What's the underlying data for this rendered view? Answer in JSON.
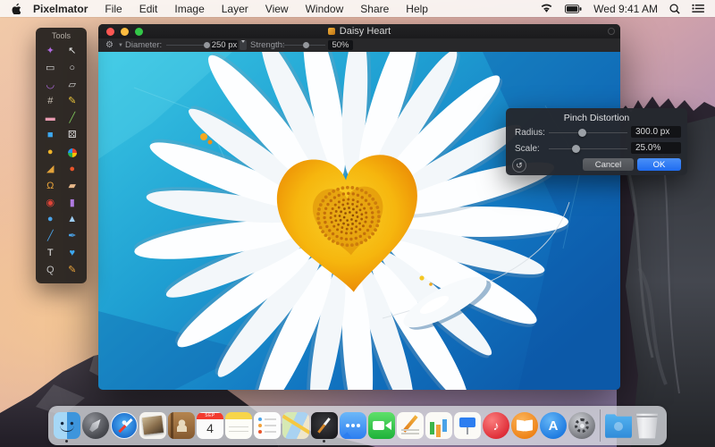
{
  "menubar": {
    "menus": [
      {
        "label": "Pixelmator",
        "bold": true
      },
      {
        "label": "File"
      },
      {
        "label": "Edit"
      },
      {
        "label": "Image"
      },
      {
        "label": "Layer"
      },
      {
        "label": "View"
      },
      {
        "label": "Window"
      },
      {
        "label": "Share"
      },
      {
        "label": "Help"
      }
    ],
    "status": {
      "clock": "Wed 9:41 AM"
    }
  },
  "tools_palette": {
    "title": "Tools",
    "tools": [
      {
        "name": "magic-wand",
        "glyph": "✦",
        "color": "#b06ae0"
      },
      {
        "name": "move",
        "glyph": "↖",
        "color": "#e8e8e8"
      },
      {
        "name": "rect-select",
        "glyph": "▭",
        "color": "#d8d8d8"
      },
      {
        "name": "ellipse-select",
        "glyph": "○",
        "color": "#d8d8d8"
      },
      {
        "name": "lasso",
        "glyph": "◡",
        "color": "#b06ae0"
      },
      {
        "name": "poly-lasso",
        "glyph": "▱",
        "color": "#d8d8d8"
      },
      {
        "name": "crop",
        "glyph": "#",
        "color": "#c8c0b4"
      },
      {
        "name": "pencil",
        "glyph": "✎",
        "color": "#e8c33a"
      },
      {
        "name": "eraser",
        "glyph": "▬",
        "color": "#e89ab0"
      },
      {
        "name": "line",
        "glyph": "╱",
        "color": "#7ec45a"
      },
      {
        "name": "rect-shape",
        "glyph": "■",
        "color": "#3da8f0"
      },
      {
        "name": "roll",
        "glyph": "⚄",
        "color": "#e0e0e0"
      },
      {
        "name": "ellipse-shape",
        "glyph": "●",
        "color": "#f0b429"
      },
      {
        "name": "gradient",
        "glyph": "",
        "color": "",
        "shape": "pinwheel"
      },
      {
        "name": "paint-bucket",
        "glyph": "◢",
        "color": "#e2a23a"
      },
      {
        "name": "color-drop",
        "glyph": "●",
        "color": "#e8542a"
      },
      {
        "name": "clone-stamp",
        "glyph": "Ω",
        "color": "#e8a23a"
      },
      {
        "name": "healing",
        "glyph": "▰",
        "color": "#e8b88a"
      },
      {
        "name": "red-eye",
        "glyph": "◉",
        "color": "#e04438"
      },
      {
        "name": "sponge",
        "glyph": "▮",
        "color": "#b07ae0"
      },
      {
        "name": "blur",
        "glyph": "●",
        "color": "#4aa3e8"
      },
      {
        "name": "sharpen",
        "glyph": "▲",
        "color": "#9ecdf2"
      },
      {
        "name": "smudge",
        "glyph": "╱",
        "color": "#4aa3e8"
      },
      {
        "name": "pen",
        "glyph": "✒",
        "color": "#4aa3e8"
      },
      {
        "name": "type",
        "glyph": "T",
        "color": "#e8e8e8"
      },
      {
        "name": "heart-shape",
        "glyph": "♥",
        "color": "#3da8f0"
      },
      {
        "name": "zoom",
        "glyph": "Q",
        "color": "#c0c0c0"
      },
      {
        "name": "eyedropper",
        "glyph": "✎",
        "color": "#e8a23a"
      }
    ]
  },
  "window": {
    "title": "Daisy Heart",
    "toolbar": {
      "diameter_label": "Diameter:",
      "diameter_value": "250 px",
      "diameter_knob_pct": 88,
      "strength_label": "Strength:",
      "strength_value": "50%",
      "strength_knob_pct": 50
    }
  },
  "pinch_dialog": {
    "title": "Pinch Distortion",
    "radius_label": "Radius:",
    "radius_value": "300.0 px",
    "radius_knob_pct": 38,
    "scale_label": "Scale:",
    "scale_value": "25.0%",
    "scale_knob_pct": 30,
    "reset_glyph": "↺",
    "cancel_label": "Cancel",
    "ok_label": "OK"
  },
  "dock": {
    "items": [
      "finder",
      "launchpad",
      "safari",
      "photos",
      "contacts",
      "calendar",
      "notes",
      "reminders",
      "maps",
      "pixelmator",
      "messages",
      "facetime",
      "pages",
      "numbers",
      "keynote",
      "itunes",
      "ibooks",
      "appstore",
      "sysprefs",
      "divider",
      "downloads",
      "trash"
    ],
    "running": [
      "finder",
      "pixelmator"
    ],
    "calendar_month": "SEP",
    "calendar_day": "4",
    "glyphs": {
      "itunes": "♪",
      "appstore": "A"
    }
  },
  "colors": {
    "ok_button": "#1f6cf0",
    "panel_bg": "#25282e",
    "canvas_teal": "#28b9d9",
    "canvas_blue": "#0f63b6",
    "heart_yellow": "#f6b60e"
  }
}
